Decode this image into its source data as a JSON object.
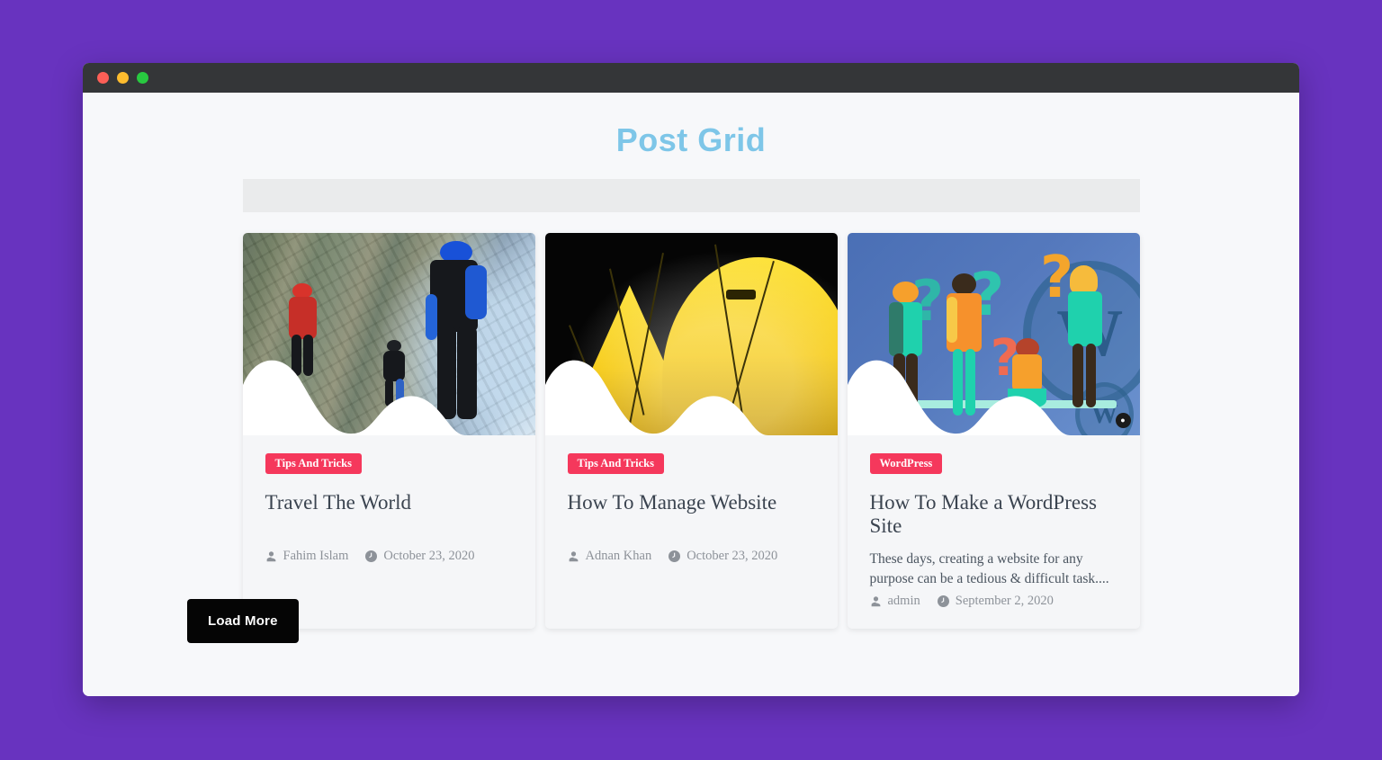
{
  "window": {
    "traffic_lights": [
      {
        "name": "close-dot",
        "color": "#fc5f57"
      },
      {
        "name": "minimize-dot",
        "color": "#fdbc2e"
      },
      {
        "name": "maximize-dot",
        "color": "#28c940"
      }
    ]
  },
  "page": {
    "title": "Post Grid",
    "title_color": "#7ec6e8",
    "background_color": "#f7f8fa",
    "outer_background_color": "#6833bf",
    "filter_bar_color": "#eaebec"
  },
  "cards": [
    {
      "category": "Tips And Tricks",
      "category_color": "#f5385c",
      "title": "Travel The World",
      "excerpt": "",
      "author": "Fahim Islam",
      "date": "October 23, 2020",
      "image_alt": "skydivers-falling-over-aerial-farmland"
    },
    {
      "category": "Tips And Tricks",
      "category_color": "#f5385c",
      "title": "How To Manage Website",
      "excerpt": "",
      "author": "Adnan Khan",
      "date": "October 23, 2020",
      "image_alt": "yellow-tent-glowing-at-night"
    },
    {
      "category": "WordPress",
      "category_color": "#f5385c",
      "title": "How To Make a WordPress Site",
      "excerpt": "These days, creating a website for any purpose can be a tedious & difficult task....",
      "author": "admin",
      "date": "September 2, 2020",
      "image_alt": "people-with-question-marks-wordpress-illustration"
    }
  ],
  "buttons": {
    "load_more": "Load More"
  },
  "icons": {
    "user": "user-icon",
    "clock": "clock-icon",
    "wordpress_w": "W"
  }
}
